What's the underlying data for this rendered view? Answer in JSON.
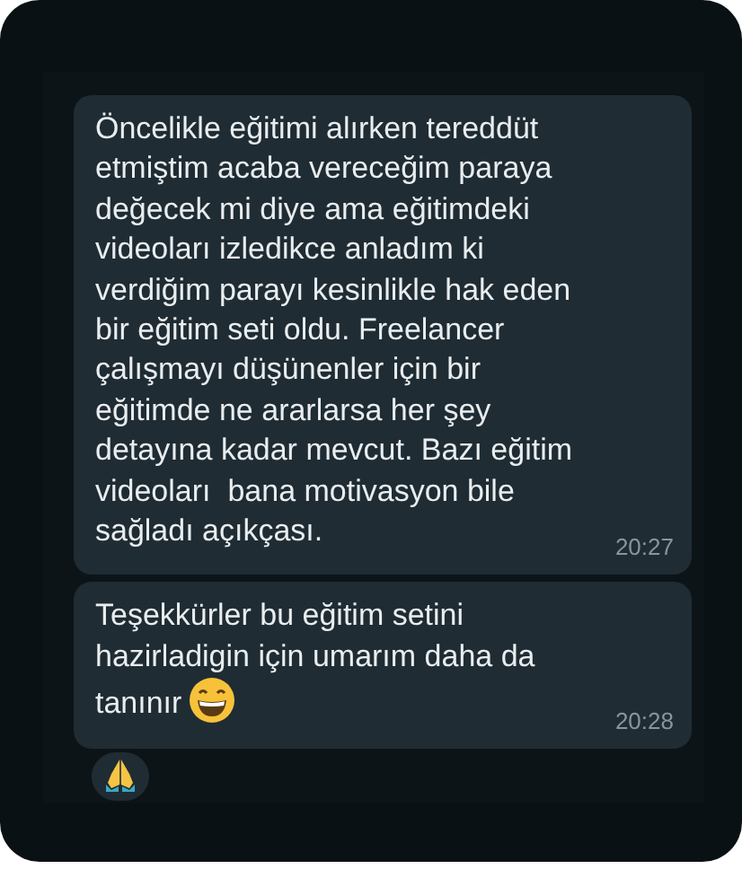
{
  "messages": [
    {
      "text": "Öncelikle eğitimi alırken tereddüt\netmiştim acaba vereceğim paraya\ndeğecek mi diye ama eğitimdeki\nvideoları izledikce anladım ki\nverdiğim parayı kesinlikle hak eden\nbir eğitim seti oldu. Freelancer\nçalışmayı düşünenler için bir\neğitimde ne ararlarsa her şey\ndetayına kadar mevcut. Bazı eğitim\nvideoları  bana motivasyon bile\nsağladı açıkçası.",
      "grin_emoji": false,
      "time": "20:27",
      "pray_reaction": false
    },
    {
      "text": "Teşekkürler bu eğitim setini\nhazirladigin için umarım daha da\ntanınır",
      "grin_emoji": true,
      "time": "20:28",
      "pray_reaction": true
    }
  ]
}
